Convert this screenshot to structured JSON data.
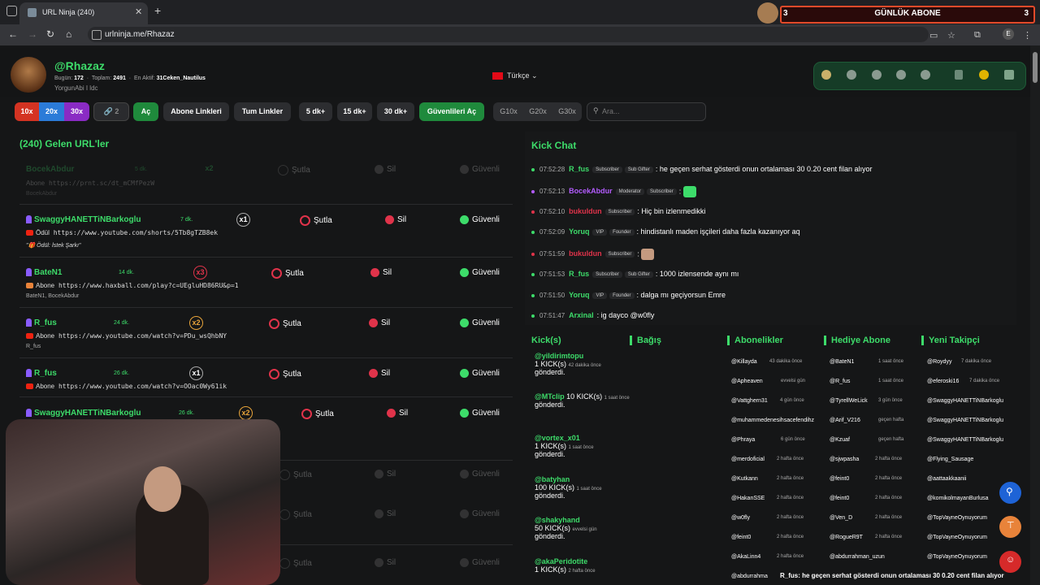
{
  "browser": {
    "tab_title": "URL Ninja (240)",
    "url": "urlninja.me/Rhazaz",
    "profile_letter": "E",
    "ad": {
      "left_num": "3",
      "text": "GÜNLÜK ABONE",
      "right_num": "3"
    }
  },
  "header": {
    "username": "@Rhazaz",
    "today_label": "Bugün:",
    "today": "172",
    "total_label": "Toplam:",
    "total": "2491",
    "last_active_label": "En Aktif:",
    "last_active": "31Ceken_Nautilus",
    "subtitle": "YorgunAbi I ldc",
    "language": "Türkçe",
    "social_icons": [
      "sun-icon",
      "twitter-icon",
      "instagram-icon",
      "discord-icon",
      "kick-icon",
      "trash-icon",
      "pause-icon",
      "logout-icon"
    ],
    "accent": "#3ddc6a"
  },
  "toolbar": {
    "b10x": "10x",
    "b20x": "20x",
    "b30x": "30x",
    "link_count": "2",
    "open": "Aç",
    "sub_links": "Abone Linkleri",
    "all_links": "Tum Linkler",
    "dk5": "5 dk+",
    "dk15": "15 dk+",
    "dk30": "30 dk+",
    "safe_open": "Güvenlileri Aç",
    "g10": "G10x",
    "g20": "G20x",
    "g30": "G30x",
    "search_placeholder": "Ara..."
  },
  "url_list": {
    "heading": "(240) Gelen URL'ler",
    "actions": {
      "ban": "Şutla",
      "delete": "Sil",
      "safe": "Güvenli"
    },
    "rows": [
      {
        "name": "BocekAbdur",
        "time": "5 dk.",
        "mult": "x2",
        "label": "Abone",
        "url": "https://prnt.sc/dt_mCMfPezW",
        "who": "BocekAbdur"
      },
      {
        "name": "SwaggyHANETTiNBarkoglu",
        "time": "7 dk.",
        "mult": "x1",
        "label": "Ödül",
        "url": "https://www.youtube.com/shorts/5Tb8gTZB8ek",
        "who": "\"🎁 Ödül: İstek Şarkı\""
      },
      {
        "name": "BateN1",
        "time": "14 dk.",
        "mult": "x3",
        "label": "Abone",
        "url": "https://www.haxball.com/play?c=UEgluHD86RU&p=1",
        "who": "BateN1, BocekAbdur"
      },
      {
        "name": "R_fus",
        "time": "24 dk.",
        "mult": "x2",
        "label": "Abone",
        "url": "https://www.youtube.com/watch?v=PDu_wsQhbNY",
        "who": "R_fus"
      },
      {
        "name": "R_fus",
        "time": "26 dk.",
        "mult": "x1",
        "label": "Abone",
        "url": "https://www.youtube.com/watch?v=OOac0Wy61ik",
        "who": ""
      },
      {
        "name": "SwaggyHANETTiNBarkoglu",
        "time": "26 dk.",
        "mult": "x2",
        "label": "",
        "url": "",
        "who": ""
      }
    ]
  },
  "chat": {
    "title": "Kick Chat",
    "messages": [
      {
        "ts": "07:52:28",
        "user": "R_fus",
        "color": "#3ddc6a",
        "badges": [
          "Subscriber",
          "Sub Gifter"
        ],
        "text": ": he geçen serhat gösterdi onun ortalaması 30 0.20 cent filan alıyor",
        "dot": "#3ddc6a"
      },
      {
        "ts": "07:52:13",
        "user": "BocekAbdur",
        "color": "#b45cff",
        "badges": [
          "Moderator",
          "Subscriber"
        ],
        "text": ":",
        "dot": "#b45cff",
        "emote": "#3ddc6a"
      },
      {
        "ts": "07:52:10",
        "user": "bukuldun",
        "color": "#e0334a",
        "badges": [
          "Subscriber"
        ],
        "text": ": Hiç bin izlenmedikki",
        "dot": "#e0334a"
      },
      {
        "ts": "07:52:09",
        "user": "Yoruq",
        "color": "#3ddc6a",
        "badges": [
          "VIP",
          "Founder"
        ],
        "text": ": hindistanlı maden işçileri daha fazla kazanıyor aq",
        "dot": "#3ddc6a"
      },
      {
        "ts": "07:51:59",
        "user": "bukuldun",
        "color": "#e0334a",
        "badges": [
          "Subscriber"
        ],
        "text": ":",
        "dot": "#e0334a",
        "emote": "#c49a80"
      },
      {
        "ts": "07:51:53",
        "user": "R_fus",
        "color": "#3ddc6a",
        "badges": [
          "Subscriber",
          "Sub Gifter"
        ],
        "text": ": 1000 izlensende aynı mı",
        "dot": "#3ddc6a"
      },
      {
        "ts": "07:51:50",
        "user": "Yoruq",
        "color": "#3ddc6a",
        "badges": [
          "VIP",
          "Founder"
        ],
        "text": ": dalga mı geçiyorsun Emre",
        "dot": "#3ddc6a"
      },
      {
        "ts": "07:51:47",
        "user": "Arxinal",
        "color": "#3ddc6a",
        "badges": [],
        "text": ": ig dayco @w0fly",
        "dot": "#3ddc6a"
      }
    ]
  },
  "sections": {
    "kicks_title": "Kick(s)",
    "donation_title": "Bağış",
    "subs_title": "Abonelikler",
    "gift_title": "Hediye Abone",
    "follow_title": "Yeni Takipçi",
    "kicks": [
      {
        "user": "@yildirimtopu",
        "amount": "1 KICK(s)",
        "time": "42 dakika önce",
        "sent": "gönderdi."
      },
      {
        "user": "@MTclip",
        "amount": "10 KICK(s)",
        "time": "1 saat önce",
        "sent": "gönderdi."
      },
      {
        "user": "@vortex_x01",
        "amount": "1 KICK(s)",
        "time": "1 saat önce",
        "sent": "gönderdi."
      },
      {
        "user": "@batyhan",
        "amount": "100 KICK(s)",
        "time": "1 saat önce",
        "sent": "gönderdi."
      },
      {
        "user": "@shakyhand",
        "amount": "50 KICK(s)",
        "time": "evvelsi gün",
        "sent": "gönderdi."
      },
      {
        "user": "@akaPeridotite",
        "amount": "1 KICK(s)",
        "time": "2 hafta önce",
        "sent": "gönderdi."
      }
    ],
    "subs": [
      {
        "user": "@Killayda",
        "time": "43 dakika önce"
      },
      {
        "user": "@Apheaven",
        "time": "evvelsi gün"
      },
      {
        "user": "@Vattghern31",
        "time": "4 gün önce"
      },
      {
        "user": "@muhammedenesihsacefendihz",
        "time": ""
      },
      {
        "user": "@Phraya",
        "time": "6 gün önce"
      },
      {
        "user": "@merdoficial",
        "time": "2 hafta önce"
      },
      {
        "user": "@Kutkann",
        "time": "2 hafta önce"
      },
      {
        "user": "@HakanSSE",
        "time": "2 hafta önce"
      },
      {
        "user": "@w0fly",
        "time": "2 hafta önce"
      },
      {
        "user": "@feint0",
        "time": "2 hafta önce"
      },
      {
        "user": "@AkaLinn4",
        "time": "2 hafta önce"
      },
      {
        "user": "@abdurrahma",
        "time": ""
      }
    ],
    "gifts": [
      {
        "user": "@BateN1",
        "time": "1 saat önce"
      },
      {
        "user": "@R_fus",
        "time": "1 saat önce"
      },
      {
        "user": "@TyrellWeLick",
        "time": "3 gün önce"
      },
      {
        "user": "@Arif_V216",
        "time": "geçen hafta"
      },
      {
        "user": "@Kzuaf",
        "time": "geçen hafta"
      },
      {
        "user": "@sjwpasha",
        "time": "2 hafta önce"
      },
      {
        "user": "@feint0",
        "time": "2 hafta önce"
      },
      {
        "user": "@feint0",
        "time": "2 hafta önce"
      },
      {
        "user": "@Ven_D",
        "time": "2 hafta önce"
      },
      {
        "user": "@RogueR9T",
        "time": "2 hafta önce"
      },
      {
        "user": "@abdurrahman_uzun",
        "time": ""
      }
    ],
    "follows": [
      {
        "user": "@Roydyy",
        "time": "7 dakika önce"
      },
      {
        "user": "@eferoski16",
        "time": "7 dakika önce"
      },
      {
        "user": "@SwaggyHANETTiNBarkoglu",
        "time": ""
      },
      {
        "user": "@SwaggyHANETTiNBarkoglu",
        "time": ""
      },
      {
        "user": "@SwaggyHANETTiNBarkoglu",
        "time": ""
      },
      {
        "user": "@Flying_Sausage",
        "time": ""
      },
      {
        "user": "@aattaakkaanii",
        "time": ""
      },
      {
        "user": "@komikolmayanBurlusa",
        "time": ""
      },
      {
        "user": "@TopVayneOynuyorum",
        "time": ""
      },
      {
        "user": "@TopVayneOynuyorum",
        "time": ""
      },
      {
        "user": "@TopVayneOynuyorum",
        "time": ""
      }
    ]
  },
  "ticker": "R_fus: he geçen serhat gösterdi onun ortalaması 30 0.20 cent filan alıyor"
}
